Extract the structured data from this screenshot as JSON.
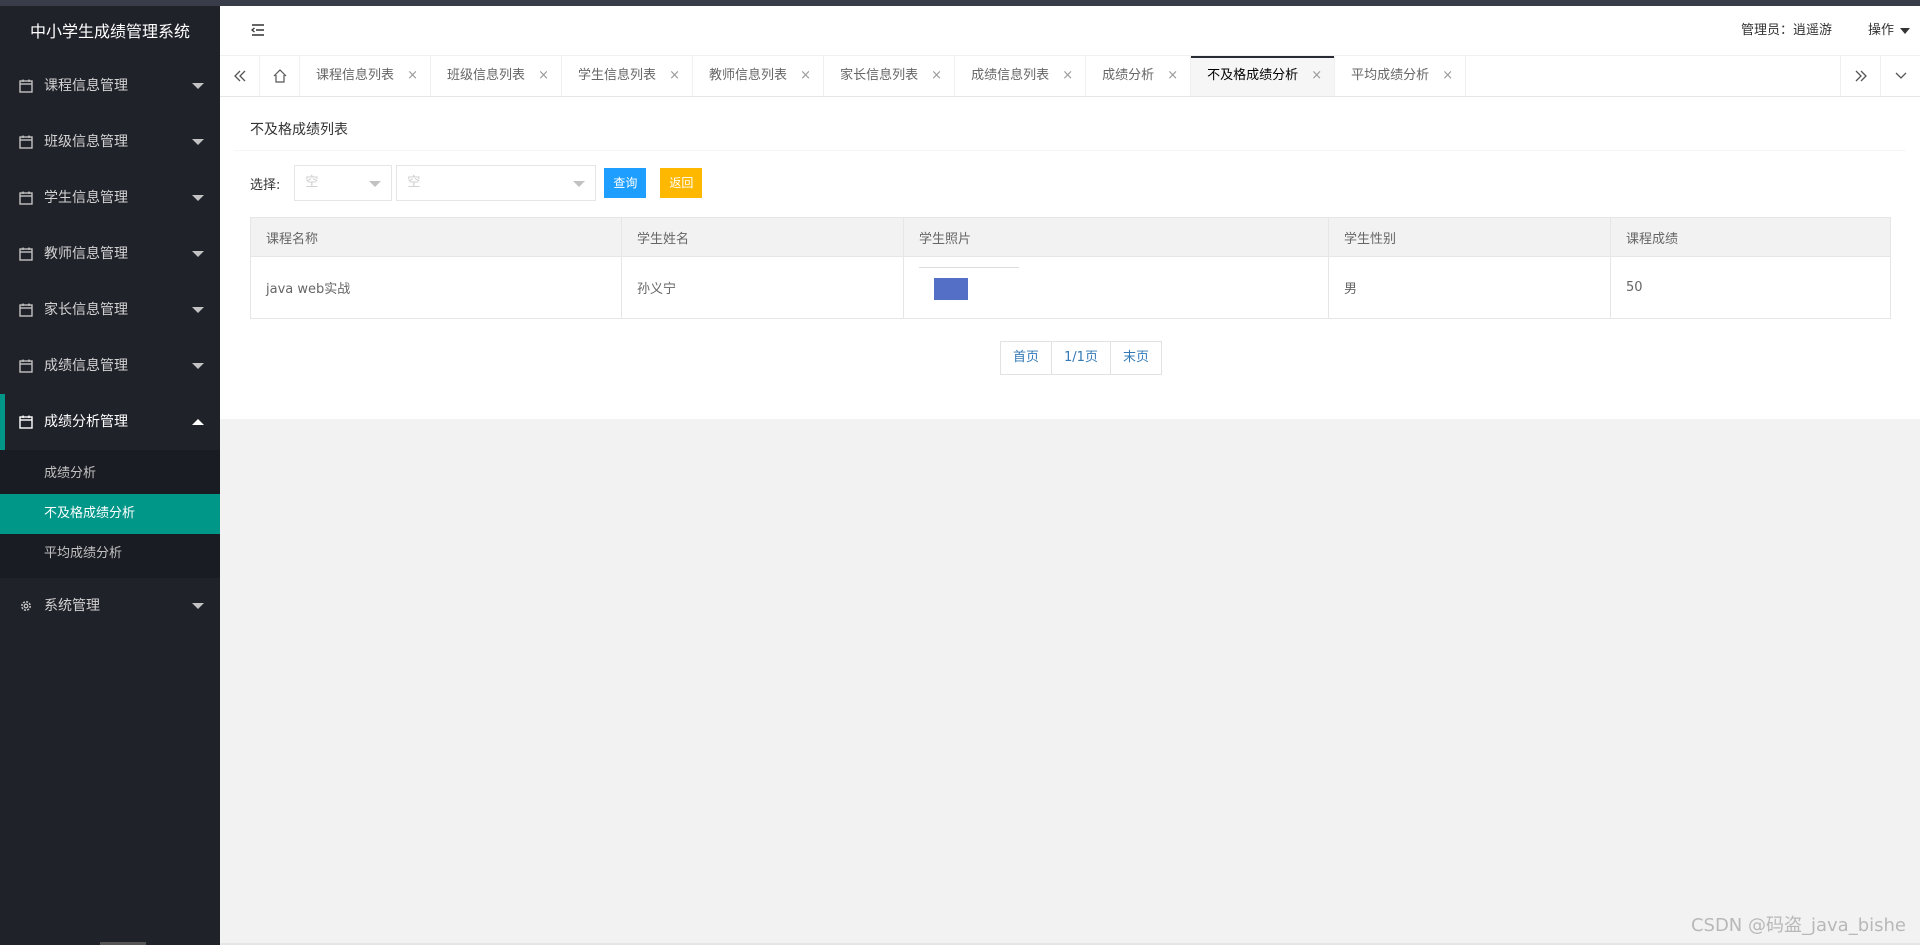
{
  "app": {
    "title": "中小学生成绩管理系统"
  },
  "sidebar": {
    "items": [
      {
        "label": "课程信息管理",
        "icon": "calendar-icon"
      },
      {
        "label": "班级信息管理",
        "icon": "calendar-icon"
      },
      {
        "label": "学生信息管理",
        "icon": "calendar-icon"
      },
      {
        "label": "教师信息管理",
        "icon": "calendar-icon"
      },
      {
        "label": "家长信息管理",
        "icon": "calendar-icon"
      },
      {
        "label": "成绩信息管理",
        "icon": "calendar-icon"
      },
      {
        "label": "成绩分析管理",
        "icon": "calendar-icon",
        "expanded": true,
        "children": [
          {
            "label": "成绩分析"
          },
          {
            "label": "不及格成绩分析",
            "active": true
          },
          {
            "label": "平均成绩分析"
          }
        ]
      },
      {
        "label": "系统管理",
        "icon": "gear-icon"
      }
    ]
  },
  "header": {
    "admin_label": "管理员：逍遥游",
    "ops_label": "操作"
  },
  "tabs": [
    {
      "label": "课程信息列表"
    },
    {
      "label": "班级信息列表"
    },
    {
      "label": "学生信息列表"
    },
    {
      "label": "教师信息列表"
    },
    {
      "label": "家长信息列表"
    },
    {
      "label": "成绩信息列表"
    },
    {
      "label": "成绩分析"
    },
    {
      "label": "不及格成绩分析",
      "active": true
    },
    {
      "label": "平均成绩分析"
    }
  ],
  "tab_close_glyph": "×",
  "main": {
    "panel_title": "不及格成绩列表",
    "filter": {
      "label": "选择:",
      "select1_value": "空",
      "select2_value": "空",
      "query_label": "查询",
      "back_label": "返回"
    },
    "table": {
      "columns": [
        "课程名称",
        "学生姓名",
        "学生照片",
        "学生性别",
        "课程成绩"
      ],
      "rows": [
        {
          "course": "java web实战",
          "student": "孙义宁",
          "photo": "thumbnail",
          "gender": "男",
          "score": "50"
        }
      ]
    },
    "pager": {
      "first": "首页",
      "page_info": "1/1页",
      "last": "末页"
    }
  },
  "watermark": "CSDN @码盗_java_bishe",
  "colors": {
    "accent": "#009688",
    "sidebar_bg": "#20222a",
    "query_btn": "#1e9fff",
    "back_btn": "#ffb800"
  }
}
